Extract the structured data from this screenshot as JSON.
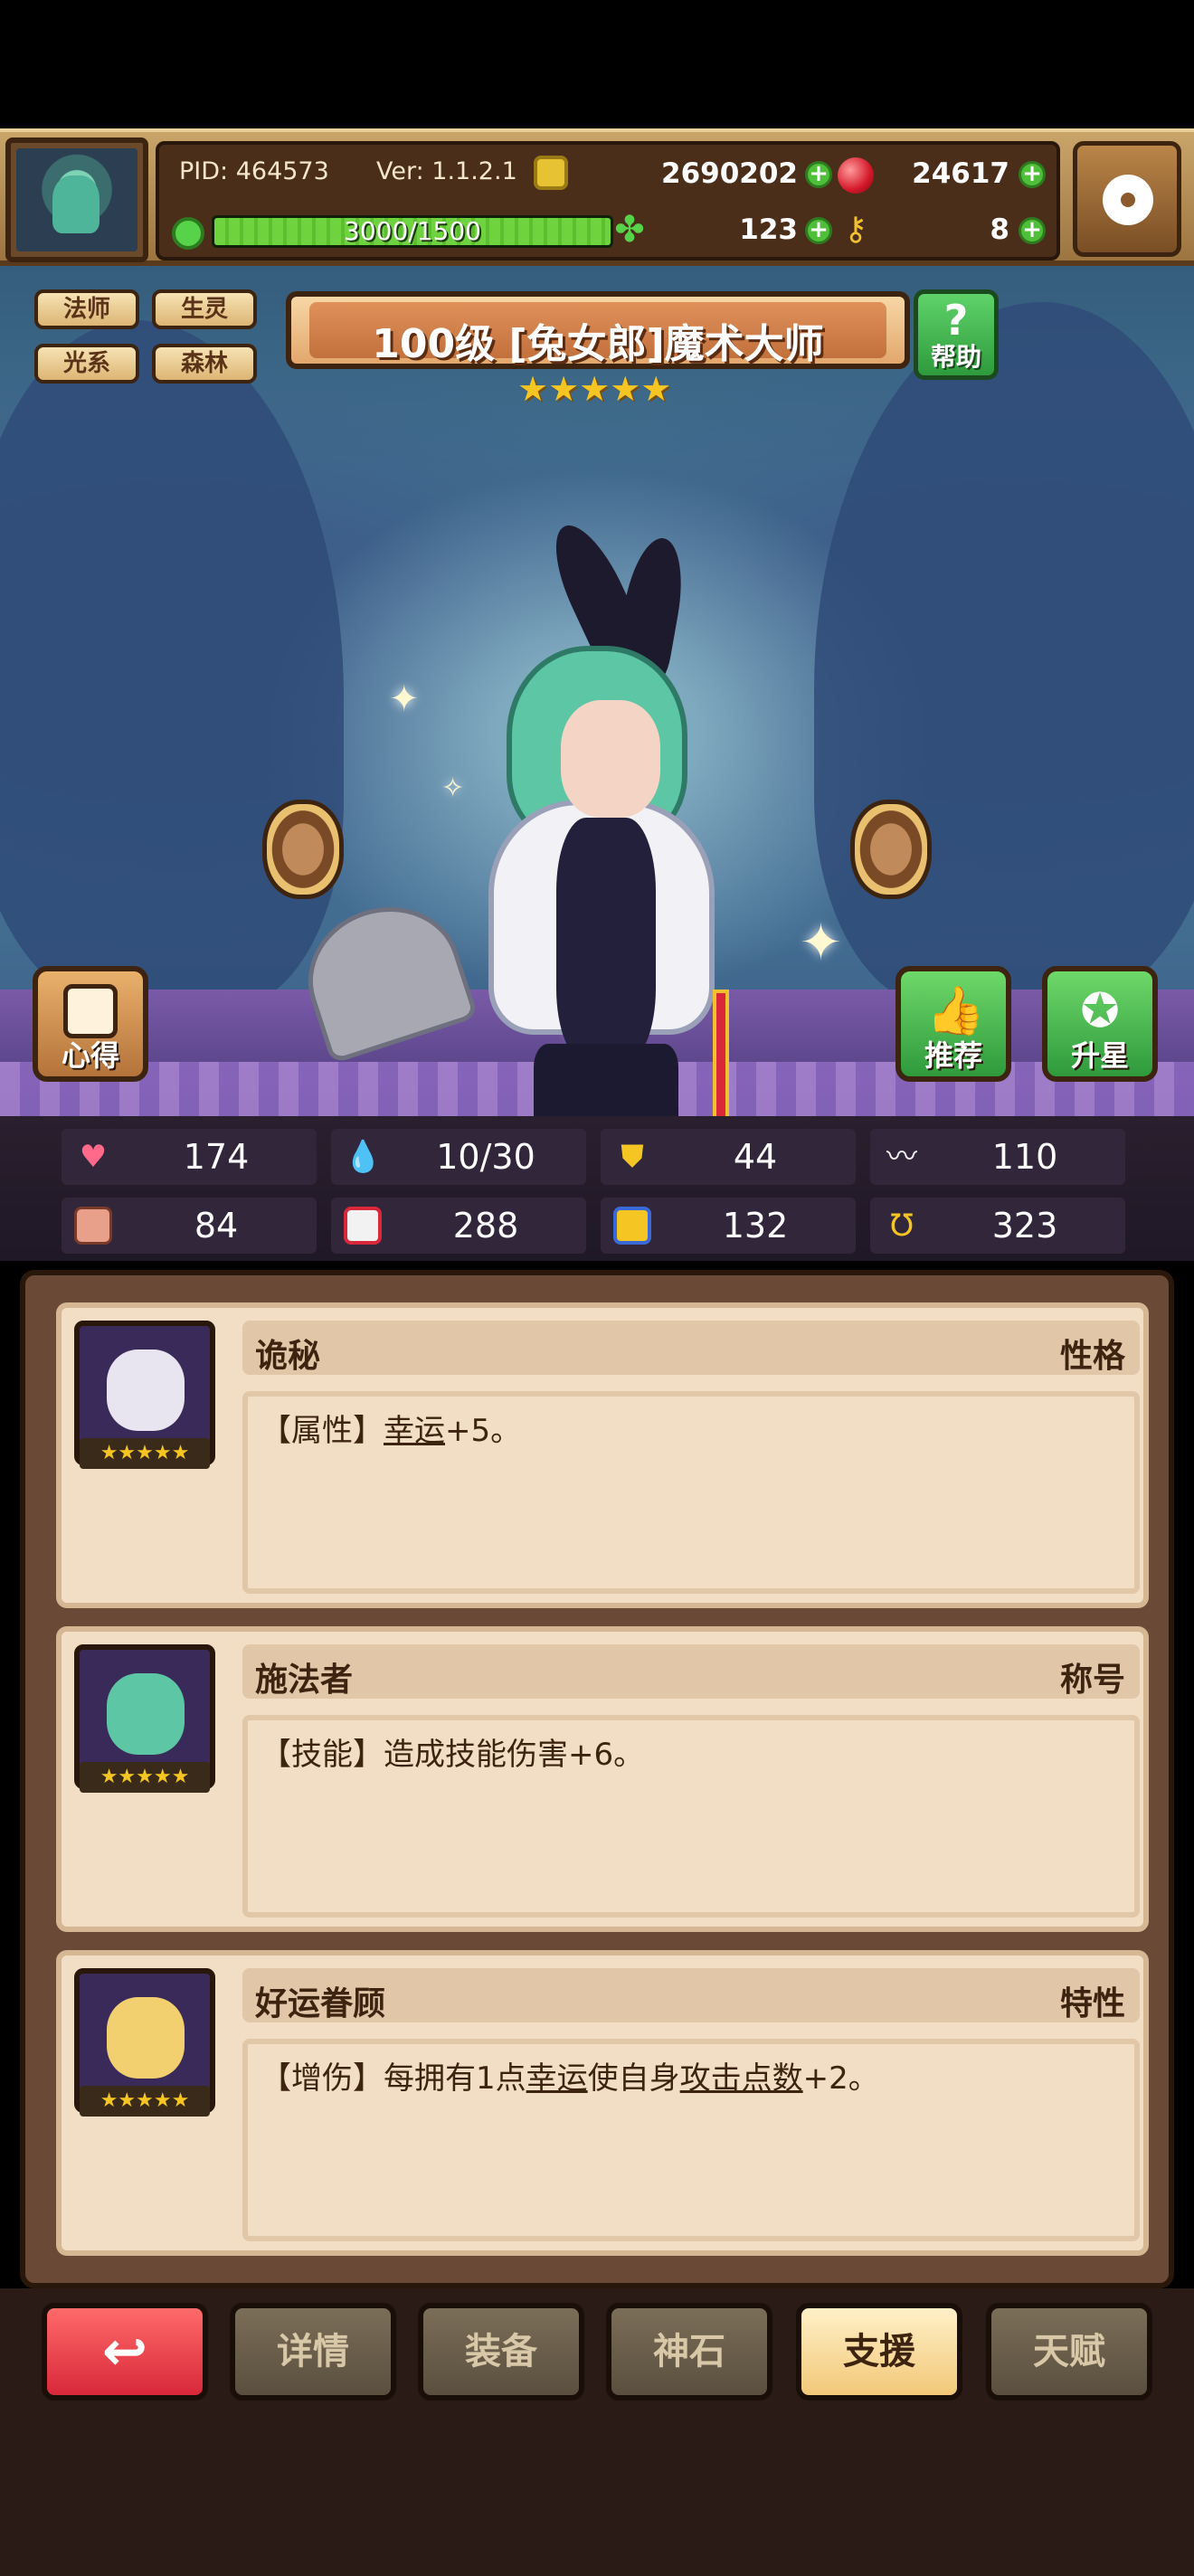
{
  "topbar": {
    "pid": "PID: 464573",
    "version": "Ver: 1.1.2.1",
    "gold": "2690202",
    "gems": "24617",
    "clover": "123",
    "keys": "8",
    "energy_text": "3000/1500",
    "energy_fraction": 1.0
  },
  "character": {
    "tags": [
      "法师",
      "生灵",
      "光系",
      "森林"
    ],
    "title": "100级 [兔女郎]魔术大师",
    "stars": "★★★★★",
    "help_label": "帮助",
    "left_button_label": "心得",
    "recommend_label": "推荐",
    "upgrade_star_label": "升星"
  },
  "stats": [
    {
      "icon": "heart-icon",
      "value": "174",
      "color": "#ff6a8a"
    },
    {
      "icon": "mana-drop-icon",
      "value": "10/30",
      "color": "#6fd6f2"
    },
    {
      "icon": "shield-icon",
      "value": "44",
      "color": "#f5c623"
    },
    {
      "icon": "wing-icon",
      "value": "110",
      "color": "#f2f2f2"
    },
    {
      "icon": "fist-icon",
      "value": "84",
      "color": "#e8a08a"
    },
    {
      "icon": "spellbook-icon",
      "value": "288",
      "color": "#e86a6a"
    },
    {
      "icon": "magic-scroll-icon",
      "value": "132",
      "color": "#6aa8f2"
    },
    {
      "icon": "horseshoe-icon",
      "value": "323",
      "color": "#f5c623"
    }
  ],
  "cards": [
    {
      "name": "诡秘",
      "type": "性格",
      "desc_prefix": "【属性】",
      "desc_link1": "幸运",
      "desc_mid": "+5。",
      "desc_link2": "",
      "desc_suffix": "",
      "portrait_color": "#e8e4f0"
    },
    {
      "name": "施法者",
      "type": "称号",
      "desc_prefix": "【技能】造成技能伤害+6。",
      "desc_link1": "",
      "desc_mid": "",
      "desc_link2": "",
      "desc_suffix": "",
      "portrait_color": "#5cc6a5"
    },
    {
      "name": "好运眷顾",
      "type": "特性",
      "desc_prefix": "【增伤】每拥有1点",
      "desc_link1": "幸运",
      "desc_mid": "使自身",
      "desc_link2": "攻击点数",
      "desc_suffix": "+2。",
      "portrait_color": "#f2d070"
    }
  ],
  "portrait_stars": "★★★★★",
  "nav": {
    "back_icon": "↩",
    "details": "详情",
    "equipment": "装备",
    "godstone": "神石",
    "support": "支援",
    "talent": "天赋"
  }
}
